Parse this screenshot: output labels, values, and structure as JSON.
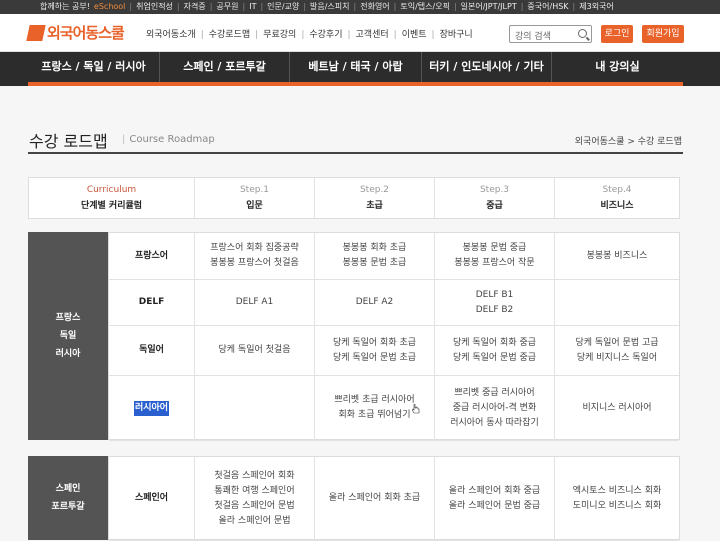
{
  "topbar": {
    "items": [
      "합께하는 공부!",
      "eSchool",
      "취업인적성",
      "자격증",
      "공무원",
      "IT",
      "인문/교양",
      "발음/스피치",
      "전화영어",
      "토익/텝스/오픽",
      "일본어/JPT/JLPT",
      "중국어/HSK",
      "제3외국어"
    ]
  },
  "header": {
    "logo": "외국어동스쿨",
    "gnb": [
      "외국어동소개",
      "수강로드맵",
      "무료강의",
      "수강후기",
      "고객센터",
      "이벤트",
      "장바구니"
    ],
    "search_placeholder": "강의 검색",
    "login": "로그인",
    "join": "회원가입"
  },
  "mainnav": [
    "프랑스 / 독일 / 러시아",
    "스페인 / 포르투갈",
    "베트남 / 태국 / 아랍",
    "터키 / 인도네시아 / 기타",
    "내 강의실"
  ],
  "page": {
    "title": "수강 로드맵",
    "subtitle": "Course Roadmap",
    "breadcrumb": "외국어동스쿨 > 수강 로드맵"
  },
  "table_header": [
    {
      "en": "Curriculum",
      "ko": "단계별 커리큘럼"
    },
    {
      "en": "Step.1",
      "ko": "입문"
    },
    {
      "en": "Step.2",
      "ko": "초급"
    },
    {
      "en": "Step.3",
      "ko": "중급"
    },
    {
      "en": "Step.4",
      "ko": "비즈니스"
    }
  ],
  "groups": [
    {
      "label_lines": [
        "프랑스",
        "독일",
        "러시아"
      ],
      "rows": [
        {
          "lang": "프랑스어",
          "step1": [
            "프랑스어 회화 집중공략",
            "봉봉봉 프랑스어 첫걸음"
          ],
          "step2": [
            "봉봉봉 회화 초급",
            "봉봉봉 문법 초급"
          ],
          "step3": [
            "봉봉봉 문법 중급",
            "봉봉봉 프랑스어 작문"
          ],
          "step4": [
            "봉봉봉 비즈니스"
          ]
        },
        {
          "lang": "DELF",
          "step1": [
            "DELF A1"
          ],
          "step2": [
            "DELF A2"
          ],
          "step3": [
            "DELF B1",
            "DELF B2"
          ],
          "step4": []
        },
        {
          "lang": "독일어",
          "step1": [
            "당케 독일어 첫걸음"
          ],
          "step2": [
            "당케 독일어 회화 초급",
            "당케 독일어 문법 초급"
          ],
          "step3": [
            "당케 독일어 회화 중급",
            "당케 독일어 문법 중급"
          ],
          "step4": [
            "당케 독일어 문법 고급",
            "당케 비지니스 독일어"
          ]
        },
        {
          "lang": "러시아어",
          "step1": [],
          "step2": [
            "쁘리벳 초급 러시아어",
            "회화 초급 뛰어넘기"
          ],
          "step3": [
            "쁘리벳 중급 러시아어",
            "중급 러시아어-격 변화",
            "러시아어 동사 따라잡기"
          ],
          "step4": [
            "비지니스 러시아어"
          ]
        }
      ]
    },
    {
      "label_lines": [
        "스페인",
        "포르투갈"
      ],
      "rows": [
        {
          "lang": "스페인어",
          "step1": [
            "첫걸음 스페인어 회화",
            "통쾌한 여행 스페인어",
            "첫걸음 스페인어 문법",
            "올라 스페인어 문법"
          ],
          "step2": [
            "올라 스페인어 회화 초급"
          ],
          "step3": [
            "올라 스페인어 회화 중급",
            "올라 스페인어 문법 중급"
          ],
          "step4": [
            "엑시토스 비즈니스 회화",
            "도미니오 비즈니스 회화"
          ]
        }
      ]
    }
  ],
  "colors": {
    "accent": "#e8622a",
    "nav_bg": "#2c2c2c",
    "side_bg": "#545454"
  }
}
